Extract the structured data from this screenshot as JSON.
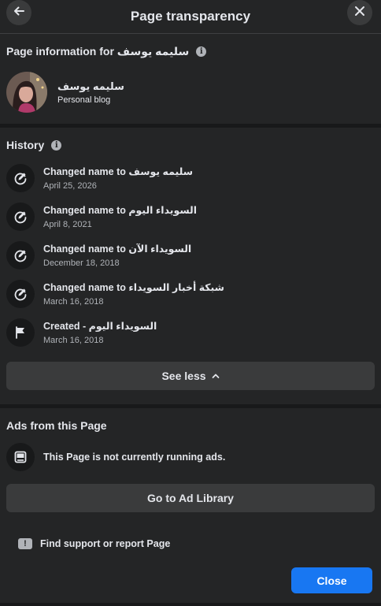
{
  "header": {
    "title": "Page transparency",
    "back_icon": "arrow-left-icon",
    "close_icon": "close-icon"
  },
  "page_info": {
    "title": "Page information for سليمه يوسف",
    "info_icon": "info-icon",
    "name": "سليمه يوسف",
    "category": "Personal blog"
  },
  "history": {
    "title": "History",
    "info_icon": "info-icon",
    "items": [
      {
        "title": "Changed name to سليمه يوسف",
        "date": "April 25, 2026",
        "icon": "edit-icon"
      },
      {
        "title": "Changed name to السويداء اليوم",
        "date": "April 8, 2021",
        "icon": "edit-icon"
      },
      {
        "title": "Changed name to السويداء الآن",
        "date": "December 18, 2018",
        "icon": "edit-icon"
      },
      {
        "title": "Changed name to شبكة أخبار السويداء",
        "date": "March 16, 2018",
        "icon": "edit-icon"
      },
      {
        "title": "Created - السويداء اليوم",
        "date": "March 16, 2018",
        "icon": "flag-icon"
      }
    ],
    "see_less_label": "See less",
    "see_less_icon": "chevron-up-icon"
  },
  "ads": {
    "title": "Ads from this Page",
    "status": "This Page is not currently running ads.",
    "status_icon": "ad-screen-icon",
    "ad_library_label": "Go to Ad Library"
  },
  "support": {
    "label": "Find support or report Page",
    "icon": "report-icon"
  },
  "footer": {
    "close_label": "Close"
  },
  "colors": {
    "background": "#242526",
    "button": "#3a3b3c",
    "primary": "#1877f2",
    "text": "#e4e6eb",
    "secondary_text": "#b0b3b8"
  }
}
